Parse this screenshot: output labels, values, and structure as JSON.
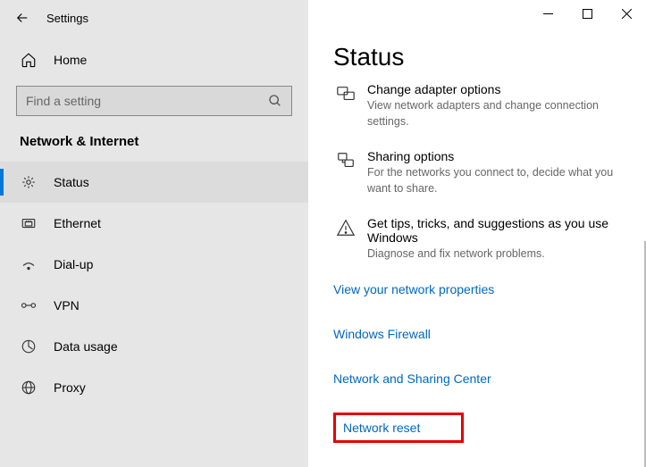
{
  "app_title": "Settings",
  "home_label": "Home",
  "search_placeholder": "Find a setting",
  "section_header": "Network & Internet",
  "nav": [
    {
      "label": "Status"
    },
    {
      "label": "Ethernet"
    },
    {
      "label": "Dial-up"
    },
    {
      "label": "VPN"
    },
    {
      "label": "Data usage"
    },
    {
      "label": "Proxy"
    }
  ],
  "page_title": "Status",
  "blocks": [
    {
      "title": "Change adapter options",
      "desc": "View network adapters and change connection settings."
    },
    {
      "title": "Sharing options",
      "desc": "For the networks you connect to, decide what you want to share."
    },
    {
      "title": "Get tips, tricks, and suggestions as you use Windows",
      "desc": "Diagnose and fix network problems."
    }
  ],
  "links": [
    "View your network properties",
    "Windows Firewall",
    "Network and Sharing Center",
    "Network reset"
  ]
}
